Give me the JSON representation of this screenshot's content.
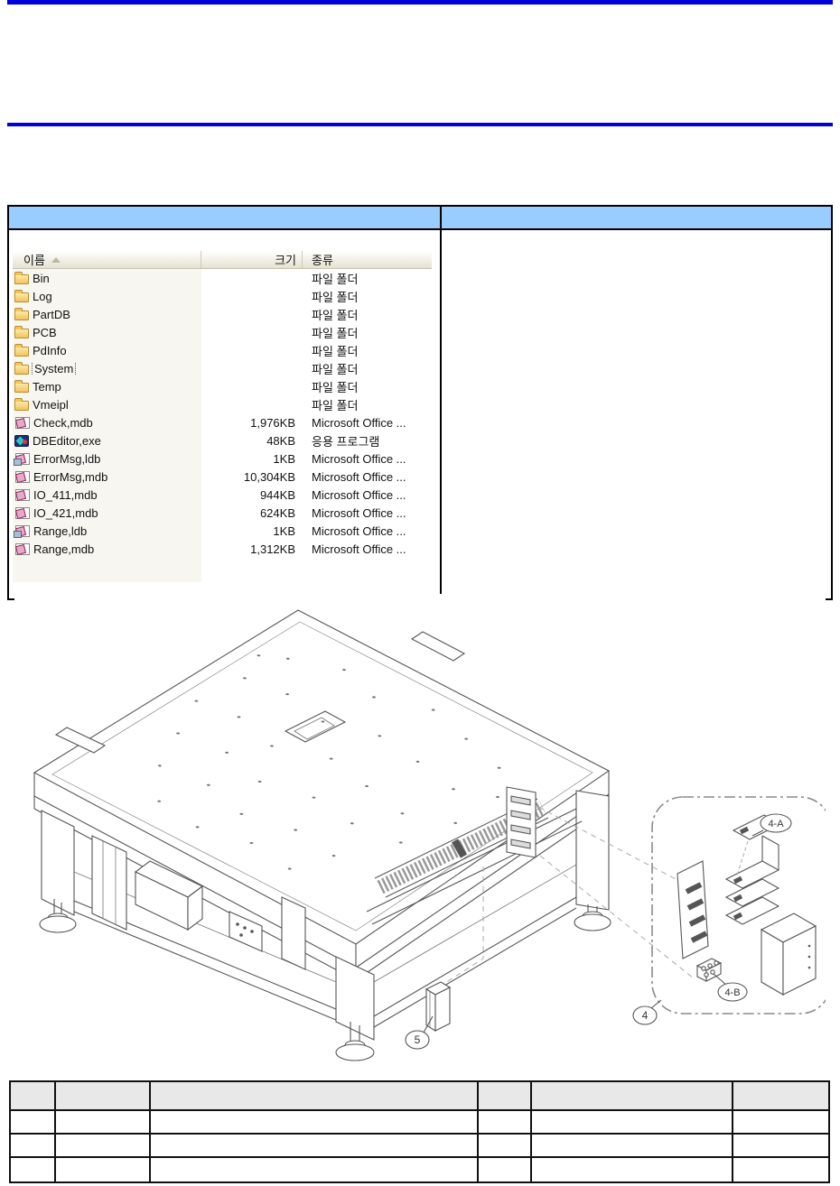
{
  "page": {
    "rule_color": "#0000DD",
    "doc_table_header_bg": "#99CCFF",
    "parts_table_header_bg": "#E8E8E8"
  },
  "doc_table": {
    "left_header_text": "",
    "right_header_text": ""
  },
  "file_explorer": {
    "columns": {
      "name": "이름",
      "size": "크기",
      "type": "종류"
    },
    "sort": "ascending",
    "focused_item": "System",
    "rows": [
      {
        "name": "Bin",
        "size": "",
        "type": "파일 폴더",
        "icon": "folder"
      },
      {
        "name": "Log",
        "size": "",
        "type": "파일 폴더",
        "icon": "folder"
      },
      {
        "name": "PartDB",
        "size": "",
        "type": "파일 폴더",
        "icon": "folder"
      },
      {
        "name": "PCB",
        "size": "",
        "type": "파일 폴더",
        "icon": "folder"
      },
      {
        "name": "PdInfo",
        "size": "",
        "type": "파일 폴더",
        "icon": "folder"
      },
      {
        "name": "System",
        "size": "",
        "type": "파일 폴더",
        "icon": "folder"
      },
      {
        "name": "Temp",
        "size": "",
        "type": "파일 폴더",
        "icon": "folder"
      },
      {
        "name": "Vmeipl",
        "size": "",
        "type": "파일 폴더",
        "icon": "folder"
      },
      {
        "name": "Check,mdb",
        "size": "1,976KB",
        "type": "Microsoft Office ...",
        "icon": "access-file"
      },
      {
        "name": "DBEditor,exe",
        "size": "48KB",
        "type": "응용 프로그램",
        "icon": "application"
      },
      {
        "name": "ErrorMsg,ldb",
        "size": "1KB",
        "type": "Microsoft Office ...",
        "icon": "access-lock-file"
      },
      {
        "name": "ErrorMsg,mdb",
        "size": "10,304KB",
        "type": "Microsoft Office ...",
        "icon": "access-file"
      },
      {
        "name": "IO_411,mdb",
        "size": "944KB",
        "type": "Microsoft Office ...",
        "icon": "access-file"
      },
      {
        "name": "IO_421,mdb",
        "size": "624KB",
        "type": "Microsoft Office ...",
        "icon": "access-file"
      },
      {
        "name": "Range,ldb",
        "size": "1KB",
        "type": "Microsoft Office ...",
        "icon": "access-lock-file"
      },
      {
        "name": "Range,mdb",
        "size": "1,312KB",
        "type": "Microsoft Office ...",
        "icon": "access-file"
      }
    ]
  },
  "diagram": {
    "callout_labels": {
      "a": "4-A",
      "b": "4-B",
      "group": "4",
      "part5": "5"
    }
  },
  "parts_table": {
    "header_cells": [
      "",
      "",
      "",
      "",
      "",
      ""
    ],
    "rows": [
      [
        "",
        "",
        "",
        "",
        "",
        ""
      ],
      [
        "",
        "",
        "",
        "",
        "",
        ""
      ],
      [
        "",
        "",
        "",
        "",
        "",
        ""
      ]
    ]
  }
}
